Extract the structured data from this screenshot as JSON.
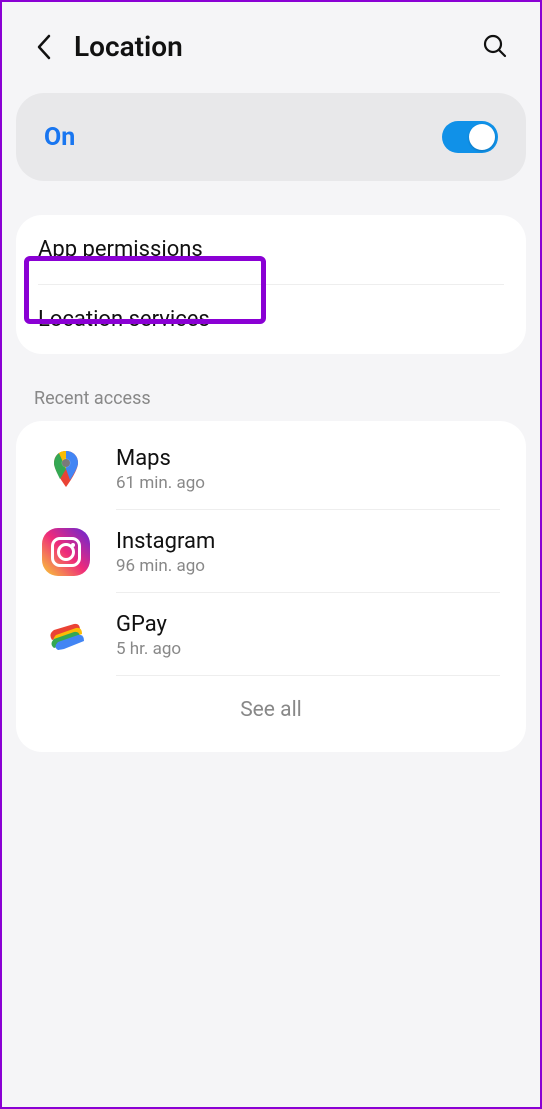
{
  "header": {
    "title": "Location"
  },
  "toggle": {
    "label": "On",
    "enabled": true
  },
  "menu": {
    "app_permissions": "App permissions",
    "location_services": "Location services"
  },
  "recent": {
    "section_title": "Recent access",
    "apps": [
      {
        "name": "Maps",
        "time": "61 min. ago",
        "icon": "maps-icon"
      },
      {
        "name": "Instagram",
        "time": "96 min. ago",
        "icon": "instagram-icon"
      },
      {
        "name": "GPay",
        "time": "5 hr. ago",
        "icon": "gpay-icon"
      }
    ],
    "see_all": "See all"
  },
  "colors": {
    "accent": "#1976f0",
    "highlight": "#8a00d4"
  }
}
